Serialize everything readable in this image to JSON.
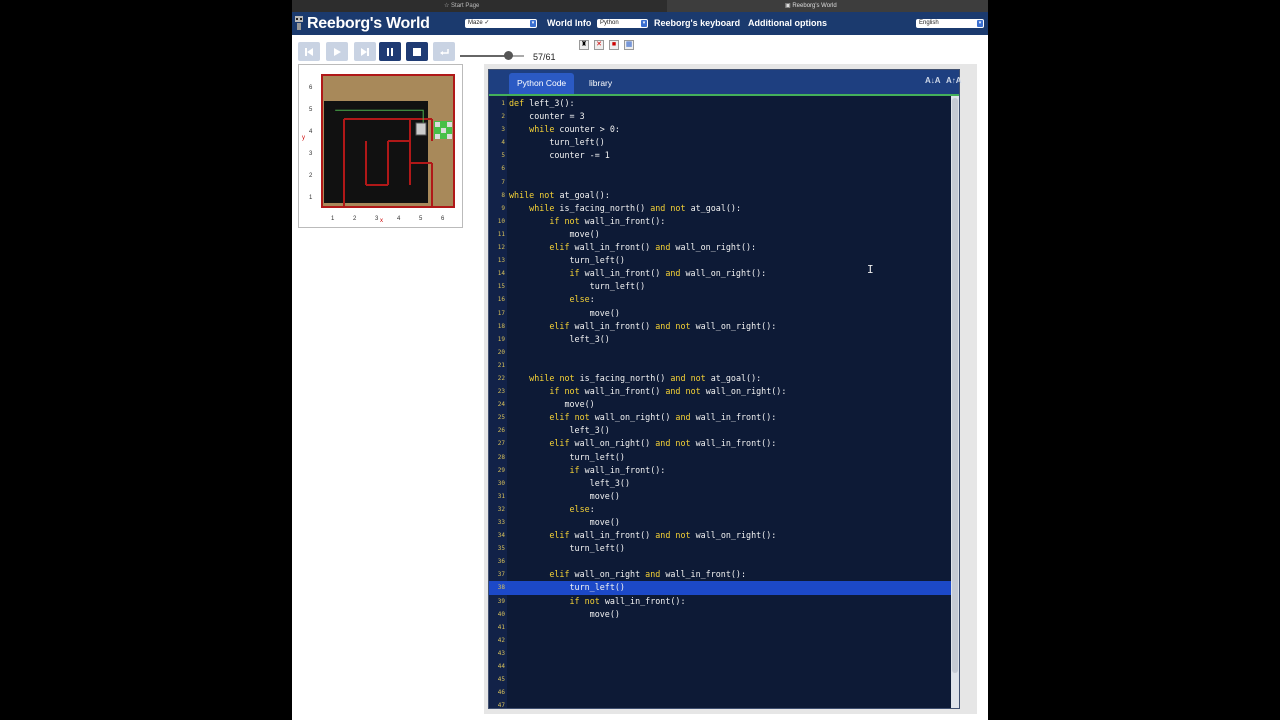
{
  "browser": {
    "tabs": [
      {
        "label": "Start Page"
      },
      {
        "label": "Reeborg's World"
      }
    ]
  },
  "header": {
    "title": "Reeborg's World",
    "world_select": "Maze ✓",
    "world_info": "World Info",
    "language_select": "Python",
    "keyboard": "Reeborg's keyboard",
    "additional_options": "Additional options",
    "locale_select": "English"
  },
  "controls": {
    "step_counter": "57/61",
    "speed_fraction": 0.75
  },
  "world": {
    "y_labels": [
      "6",
      "5",
      "4",
      "3",
      "2",
      "1"
    ],
    "x_labels": [
      "1",
      "2",
      "3",
      "4",
      "5",
      "6"
    ],
    "y_axis_letter": "y",
    "x_axis_letter": "x",
    "colors": {
      "floor": "#a8895a",
      "wall": "#b01818",
      "goal": "#48c048"
    }
  },
  "editor": {
    "tab_code": "Python Code",
    "tab_library": "library",
    "font_decrease": "A↓A",
    "font_increase": "A↑A",
    "highlight_line": 38,
    "lines": [
      "def left_3():",
      "    counter = 3",
      "    while counter > 0:",
      "        turn_left()",
      "        counter -= 1",
      "",
      "",
      "while not at_goal():",
      "    while is_facing_north() and not at_goal():",
      "        if not wall_in_front():",
      "            move()",
      "        elif wall_in_front() and wall_on_right():",
      "            turn_left()",
      "            if wall_in_front() and wall_on_right():",
      "                turn_left()",
      "            else:",
      "                move()",
      "        elif wall_in_front() and not wall_on_right():",
      "            left_3()",
      "",
      "",
      "    while not is_facing_north() and not at_goal():",
      "        if not wall_in_front() and not wall_on_right():",
      "           move()",
      "        elif not wall_on_right() and wall_in_front():",
      "            left_3()",
      "        elif wall_on_right() and not wall_in_front():",
      "            turn_left()",
      "            if wall_in_front():",
      "                left_3()",
      "                move()",
      "            else:",
      "                move()",
      "        elif wall_in_front() and not wall_on_right():",
      "            turn_left()",
      "",
      "        elif wall_on_right and wall_in_front():",
      "            turn_left()",
      "            if not wall_in_front():",
      "                move()",
      "",
      "",
      "",
      "",
      "",
      "",
      ""
    ]
  }
}
